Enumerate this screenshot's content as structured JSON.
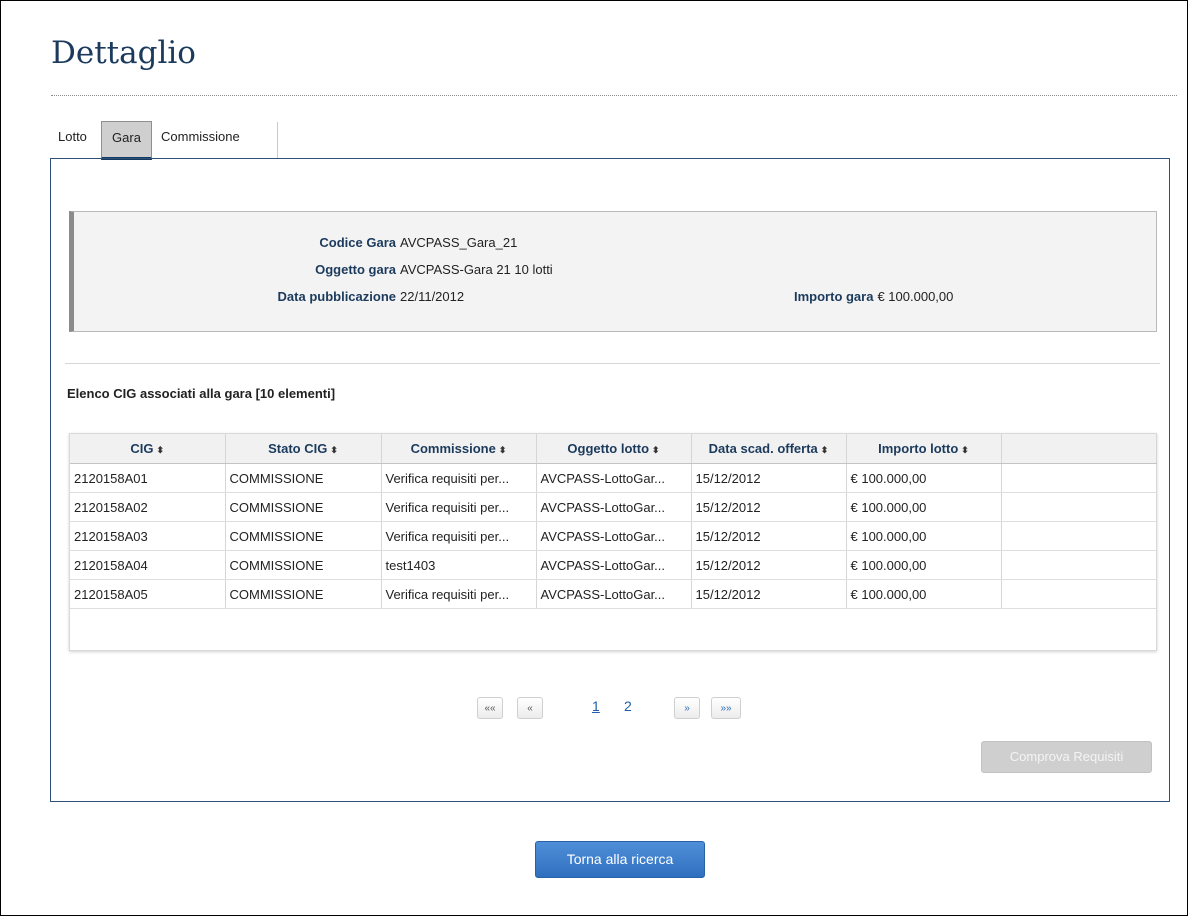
{
  "page": {
    "title": "Dettaglio"
  },
  "tabs": [
    {
      "label": "Lotto"
    },
    {
      "label": "Gara"
    },
    {
      "label": "Commissione"
    }
  ],
  "gara": {
    "codice_label": "Codice Gara",
    "codice_value": "AVCPASS_Gara_21",
    "oggetto_label": "Oggetto gara",
    "oggetto_value": "AVCPASS-Gara 21 10 lotti",
    "data_label": "Data pubblicazione",
    "data_value": "22/11/2012",
    "importo_label": "Importo gara",
    "importo_value": "€ 100.000,00"
  },
  "list": {
    "title": "Elenco CIG associati alla gara [10 elementi]",
    "columns": [
      "CIG",
      "Stato CIG",
      "Commissione",
      "Oggetto lotto",
      "Data scad. offerta",
      "Importo lotto"
    ],
    "sort_glyph": "⬍",
    "rows": [
      [
        "2120158A01",
        "COMMISSIONE",
        "Verifica requisiti per...",
        "AVCPASS-LottoGar...",
        "15/12/2012",
        "€ 100.000,00"
      ],
      [
        "2120158A02",
        "COMMISSIONE",
        "Verifica requisiti per...",
        "AVCPASS-LottoGar...",
        "15/12/2012",
        "€ 100.000,00"
      ],
      [
        "2120158A03",
        "COMMISSIONE",
        "Verifica requisiti per...",
        "AVCPASS-LottoGar...",
        "15/12/2012",
        "€ 100.000,00"
      ],
      [
        "2120158A04",
        "COMMISSIONE",
        "test1403",
        "AVCPASS-LottoGar...",
        "15/12/2012",
        "€ 100.000,00"
      ],
      [
        "2120158A05",
        "COMMISSIONE",
        "Verifica requisiti per...",
        "AVCPASS-LottoGar...",
        "15/12/2012",
        "€ 100.000,00"
      ]
    ]
  },
  "pager": {
    "first": "««",
    "prev": "«",
    "next": "»",
    "last": "»»",
    "pages": [
      "1",
      "2"
    ],
    "current": "1"
  },
  "buttons": {
    "comprova": "Comprova Requisiti",
    "torna": "Torna alla ricerca"
  }
}
